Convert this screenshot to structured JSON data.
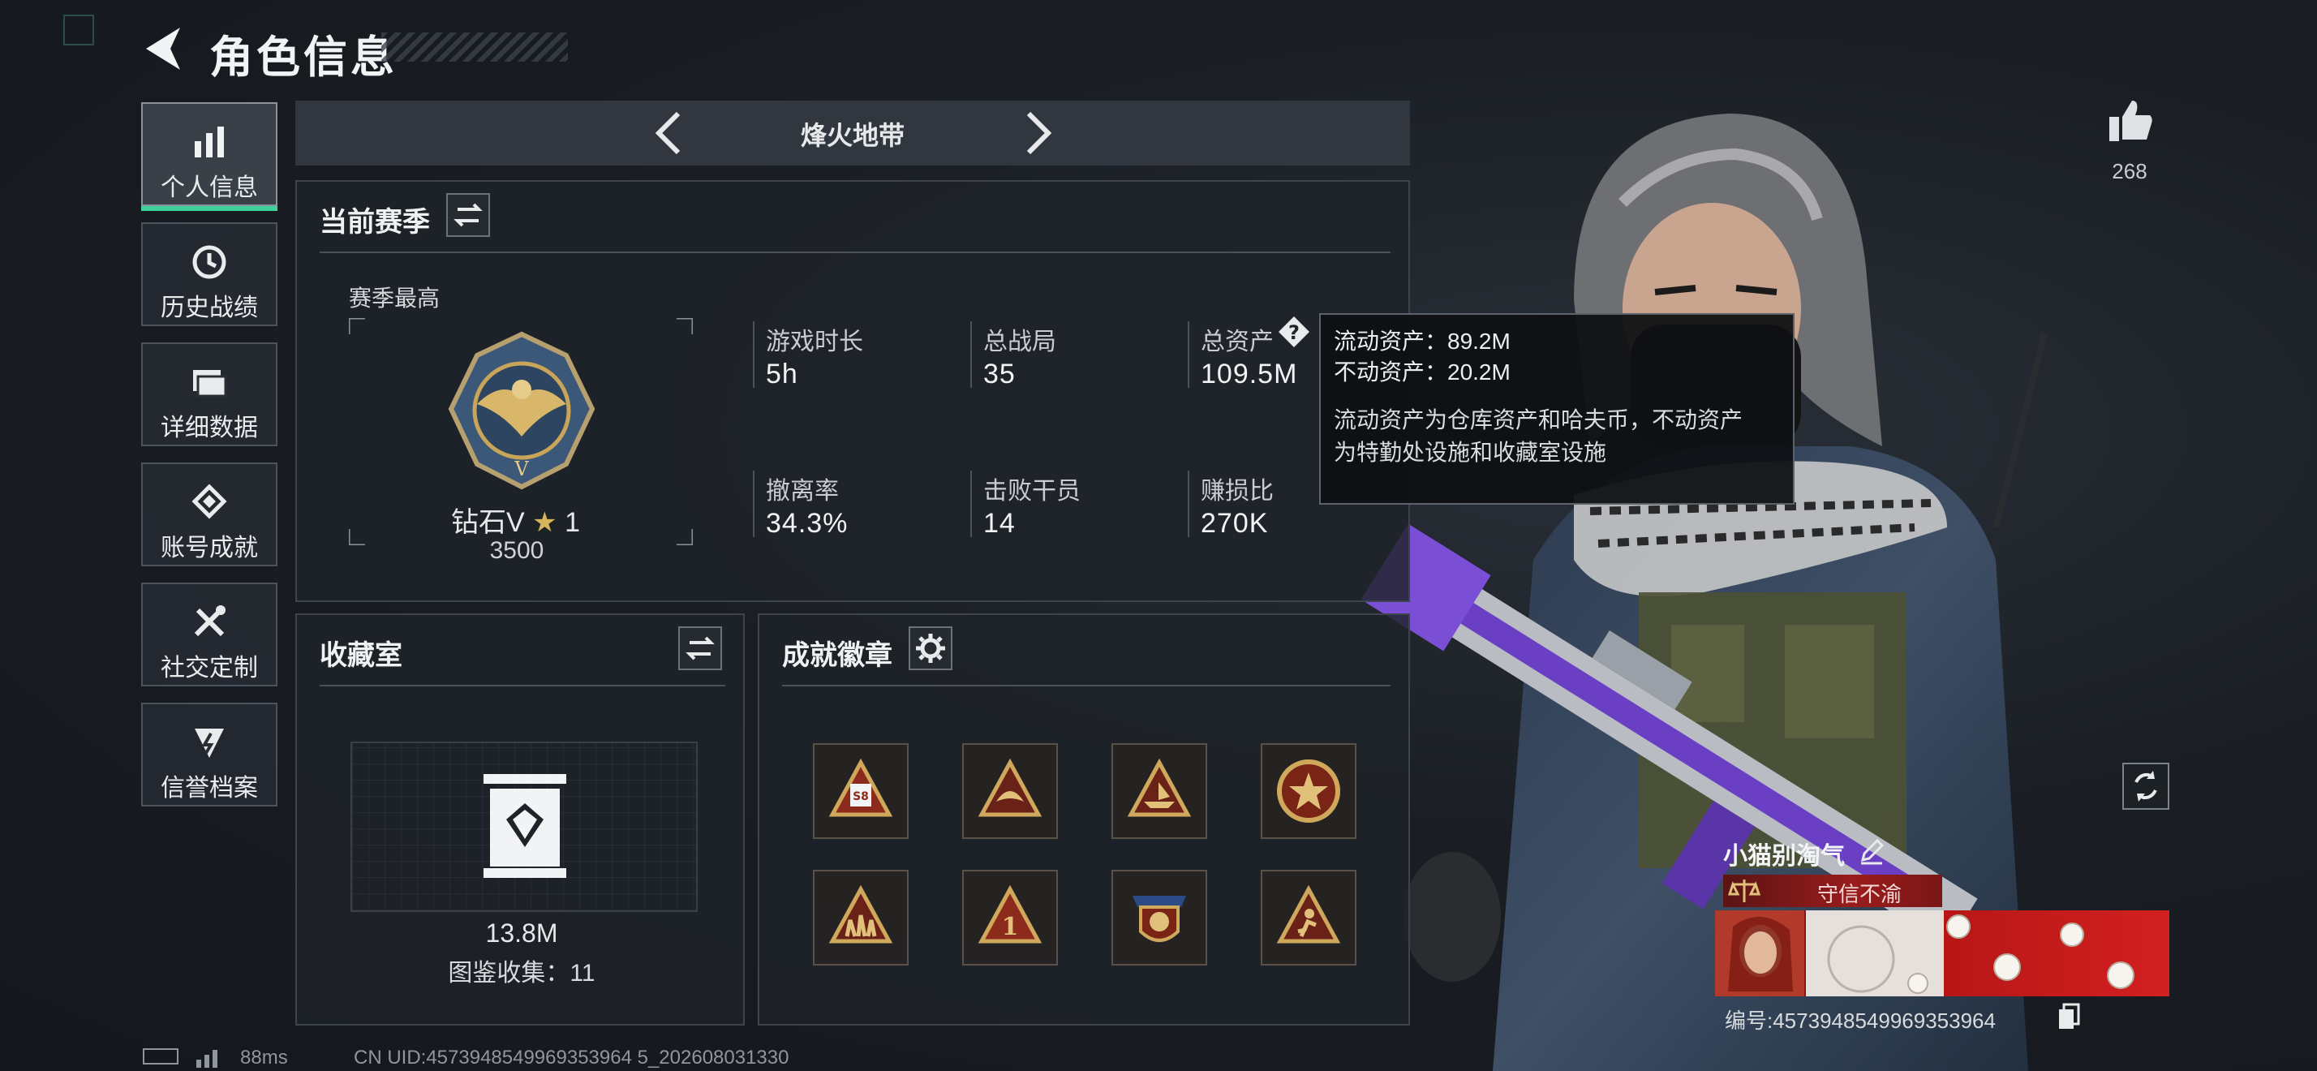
{
  "header": {
    "title": "角色信息"
  },
  "sidebar": {
    "items": [
      {
        "label": "个人信息",
        "icon": "bar-chart-icon",
        "active": true
      },
      {
        "label": "历史战绩",
        "icon": "history-clock-icon"
      },
      {
        "label": "详细数据",
        "icon": "folder-icon"
      },
      {
        "label": "账号成就",
        "icon": "achievement-icon"
      },
      {
        "label": "社交定制",
        "icon": "tools-icon"
      },
      {
        "label": "信誉档案",
        "icon": "shield-flash-icon"
      }
    ]
  },
  "mode": {
    "label": "烽火地带"
  },
  "season": {
    "title": "当前赛季",
    "best_label": "赛季最高",
    "rank_name": "钻石V",
    "rank_stars": "1",
    "rank_score": "3500",
    "stats": [
      {
        "label": "游戏时长",
        "value": "5h"
      },
      {
        "label": "总战局",
        "value": "35"
      },
      {
        "label": "总资产",
        "value": "109.5M"
      },
      {
        "label": "撤离率",
        "value": "34.3%"
      },
      {
        "label": "击败干员",
        "value": "14"
      },
      {
        "label": "赚损比",
        "value": "270K"
      }
    ]
  },
  "tooltip": {
    "liquid": "流动资产：89.2M",
    "fixed": "不动资产：20.2M",
    "note_line1": "流动资产为仓库资产和哈夫币，不动资产",
    "note_line2": "为特勤处设施和收藏室设施"
  },
  "collection": {
    "title": "收藏室",
    "value": "13.8M",
    "count_text": "图鉴收集：11"
  },
  "badges": {
    "title": "成就徽章",
    "items": [
      {
        "icon": "s8-badge-icon",
        "text": "S8"
      },
      {
        "icon": "bird-badge-icon"
      },
      {
        "icon": "boat-badge-icon"
      },
      {
        "icon": "star-medal-icon"
      },
      {
        "icon": "squad-badge-icon"
      },
      {
        "icon": "number-one-badge-icon",
        "text": "1"
      },
      {
        "icon": "crest-shield-icon"
      },
      {
        "icon": "runner-badge-icon"
      }
    ]
  },
  "social": {
    "likes": "268"
  },
  "player": {
    "name": "小猫别淘气",
    "title": "守信不渝",
    "id": "编号:4573948549969353964"
  },
  "status": {
    "ping": "88ms",
    "uid": "CN UID:4573948549969353964 5_202608031330"
  },
  "colors": {
    "accent": "#3ed29a",
    "title_red": "#9a1c1c",
    "gold": "#c9a55a"
  }
}
